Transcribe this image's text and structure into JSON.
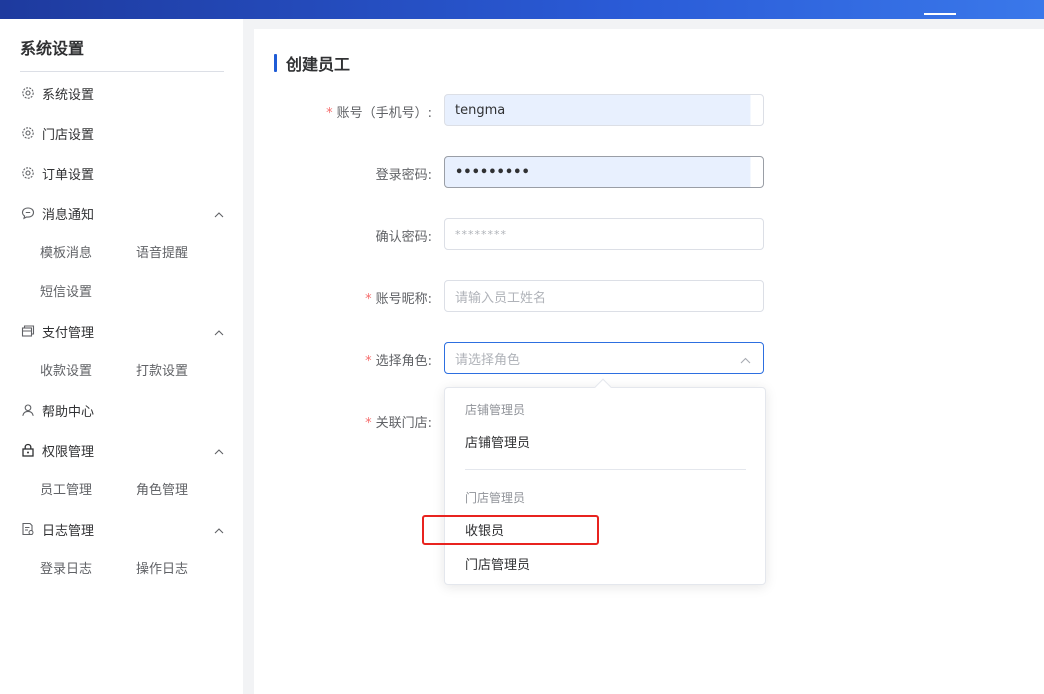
{
  "sidebar": {
    "title": "系统设置",
    "items": [
      {
        "label": "系统设置",
        "icon": "gear-icon"
      },
      {
        "label": "门店设置",
        "icon": "gear-icon"
      },
      {
        "label": "订单设置",
        "icon": "gear-icon"
      },
      {
        "label": "消息通知",
        "icon": "message-icon",
        "expanded": true,
        "children": [
          "模板消息",
          "语音提醒",
          "短信设置"
        ]
      },
      {
        "label": "支付管理",
        "icon": "card-icon",
        "expanded": true,
        "children": [
          "收款设置",
          "打款设置"
        ]
      },
      {
        "label": "帮助中心",
        "icon": "user-icon"
      },
      {
        "label": "权限管理",
        "icon": "lock-icon",
        "expanded": true,
        "children": [
          "员工管理",
          "角色管理"
        ]
      },
      {
        "label": "日志管理",
        "icon": "log-icon",
        "expanded": true,
        "children": [
          "登录日志",
          "操作日志"
        ]
      }
    ]
  },
  "page": {
    "title": "创建员工"
  },
  "form": {
    "account": {
      "label": "账号（手机号）:",
      "required": true,
      "value": "tengma"
    },
    "password": {
      "label": "登录密码:",
      "required": false,
      "value": "•••••••••"
    },
    "confirm": {
      "label": "确认密码:",
      "required": false,
      "value": "********"
    },
    "nickname": {
      "label": "账号昵称:",
      "required": true,
      "placeholder": "请输入员工姓名"
    },
    "role": {
      "label": "选择角色:",
      "required": true,
      "placeholder": "请选择角色"
    },
    "store": {
      "label": "关联门店:",
      "required": true
    }
  },
  "dropdown": {
    "groups": [
      {
        "label": "店铺管理员",
        "options": [
          "店铺管理员"
        ]
      },
      {
        "label": "门店管理员",
        "options": [
          "收银员",
          "门店管理员"
        ]
      }
    ]
  },
  "colors": {
    "accent": "#1f5cd6",
    "required": "#f56c6c",
    "highlight": "#e8231f"
  }
}
